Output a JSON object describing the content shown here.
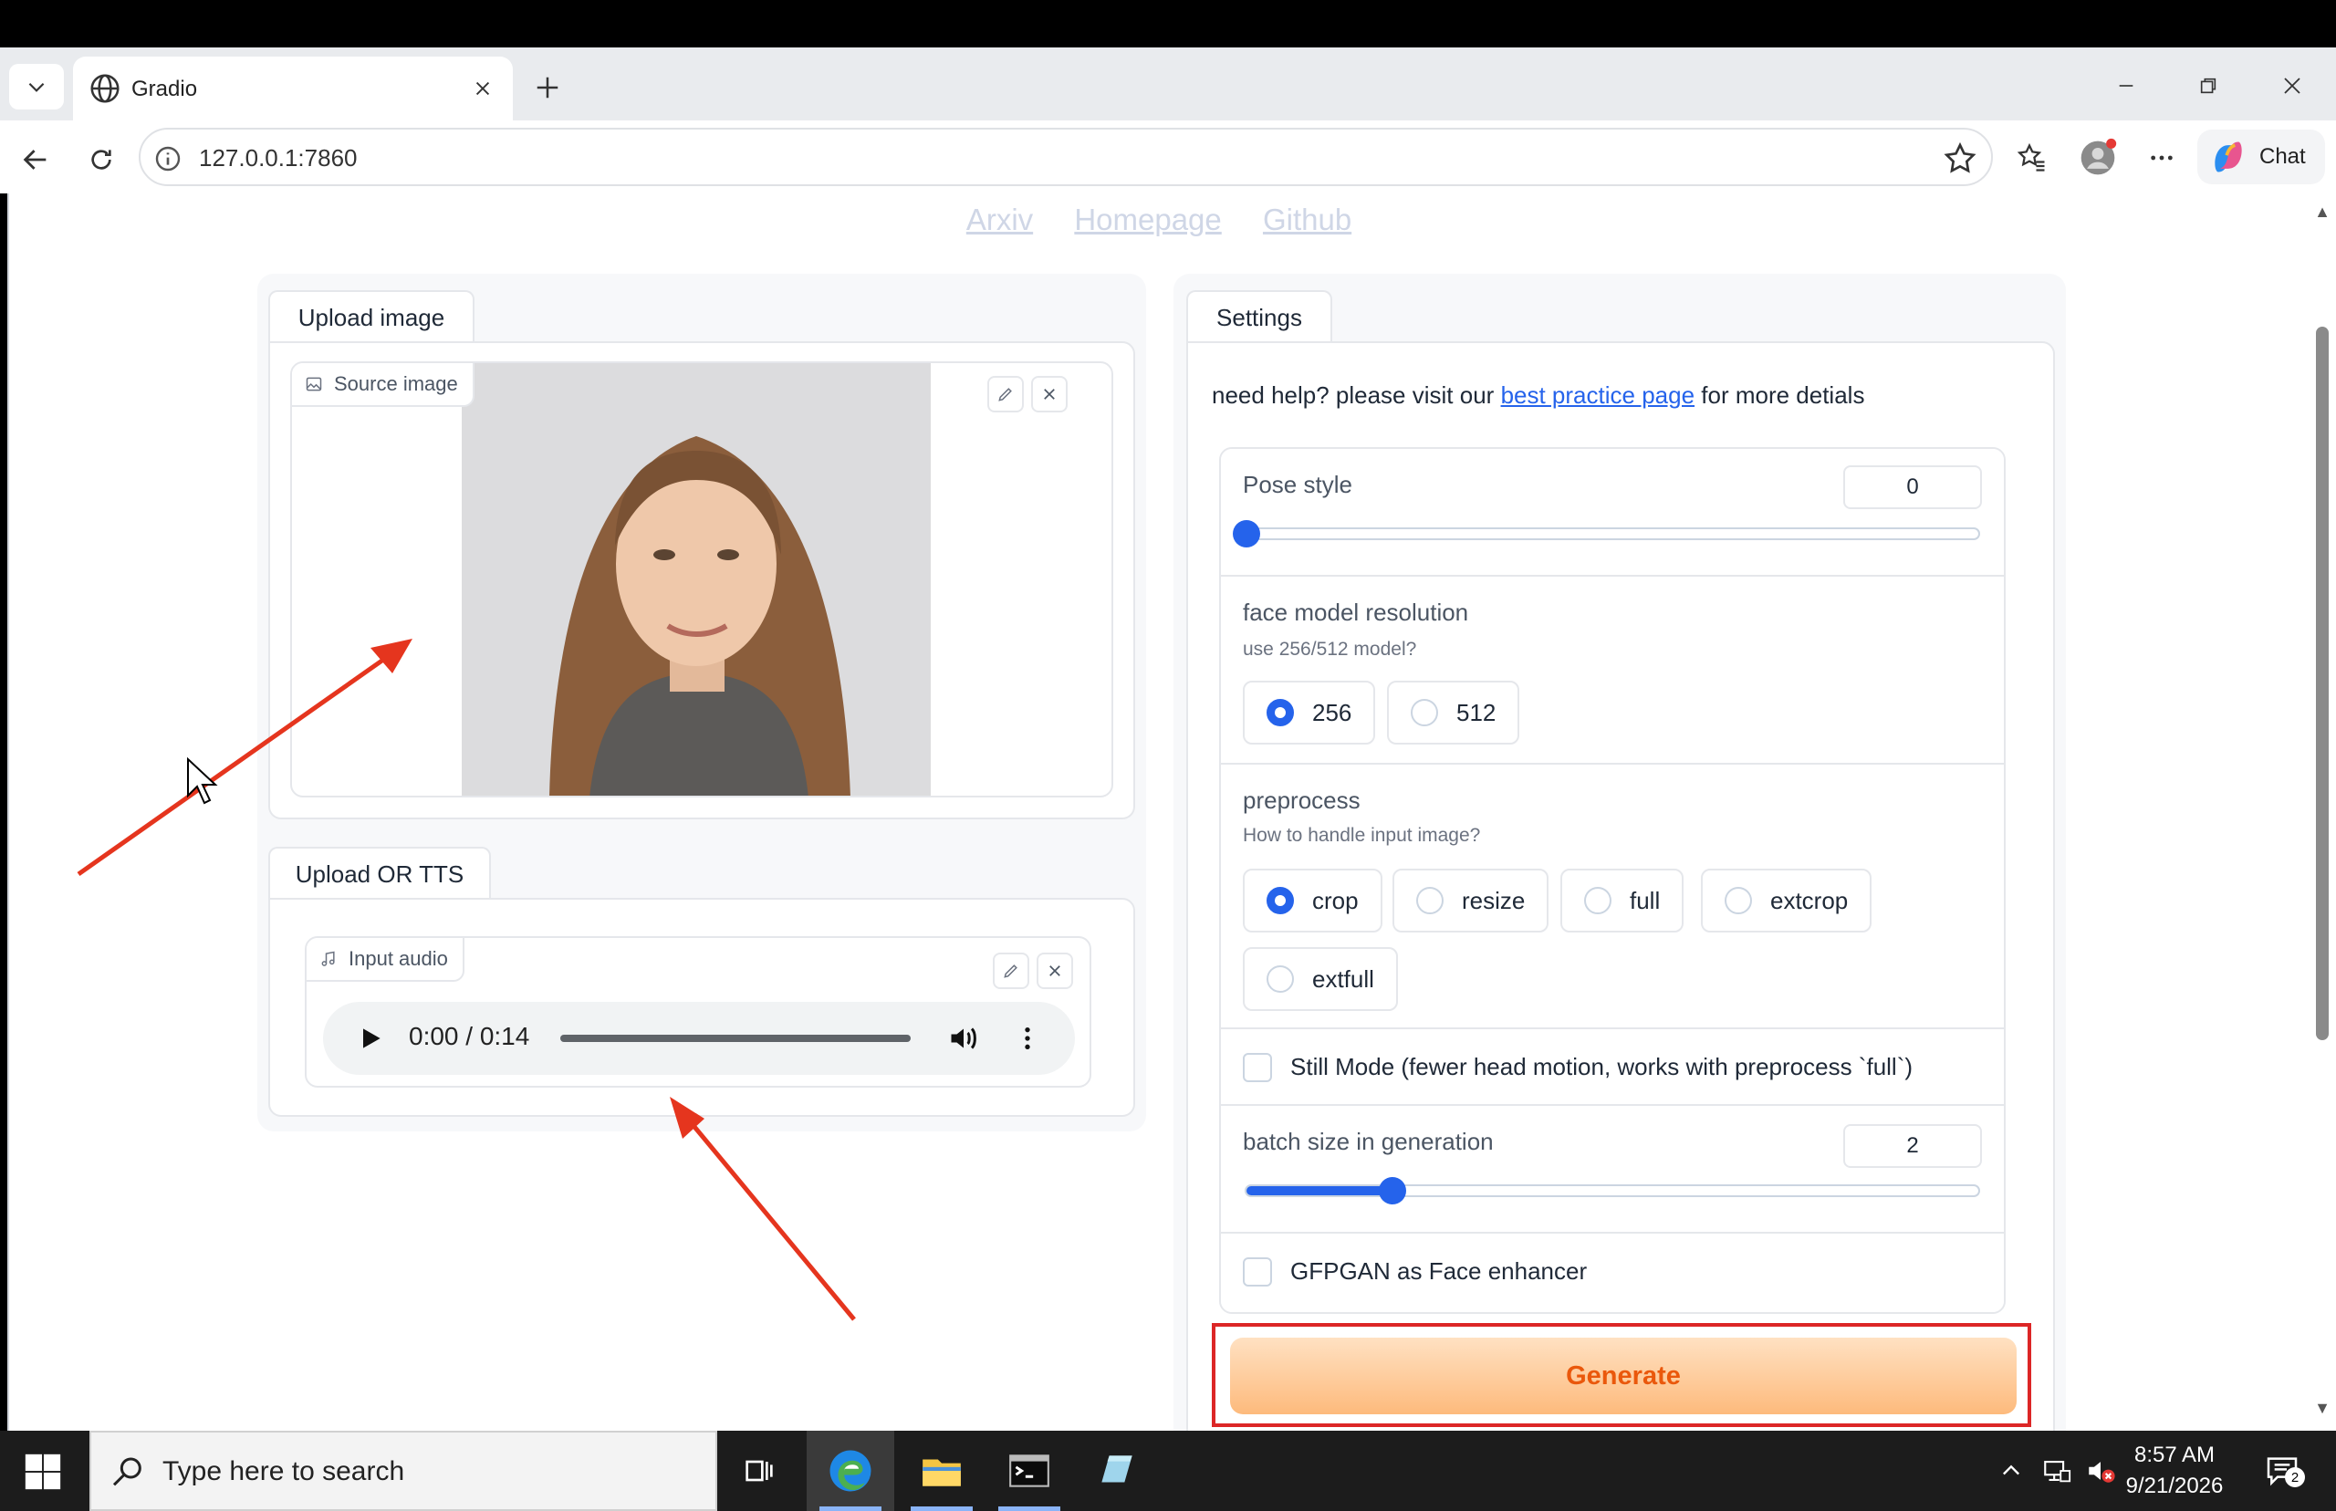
{
  "browser": {
    "tab_title": "Gradio",
    "url": "127.0.0.1:7860",
    "chat_label": "Chat"
  },
  "page": {
    "links": [
      "Arxiv",
      "Homepage",
      "Github"
    ],
    "upload_image_tab": "Upload image",
    "source_image_label": "Source image",
    "upload_tts_tab": "Upload OR TTS",
    "input_audio_label": "Input audio",
    "audio_time": "0:00 / 0:14",
    "settings_tab": "Settings",
    "help_prefix": "need help? please visit our",
    "help_link": "best practice page",
    "help_suffix": "for more detials"
  },
  "settings": {
    "pose_style": {
      "label": "Pose style",
      "value": "0",
      "fraction": 0.0
    },
    "face_model": {
      "label": "face model resolution",
      "info": "use 256/512 model?",
      "options": [
        "256",
        "512"
      ],
      "selected": "256"
    },
    "preprocess": {
      "label": "preprocess",
      "info": "How to handle input image?",
      "options": [
        "crop",
        "resize",
        "full",
        "extcrop",
        "extfull"
      ],
      "selected": "crop"
    },
    "still_mode": {
      "label": "Still Mode (fewer head motion, works with preprocess `full`)",
      "checked": false
    },
    "batch_size": {
      "label": "batch size in generation",
      "value": "2",
      "fraction": 0.2
    },
    "gfpgan": {
      "label": "GFPGAN as Face enhancer",
      "checked": false
    },
    "generate_label": "Generate"
  },
  "taskbar": {
    "search_placeholder": "Type here to search",
    "time": "8:57 AM",
    "date": "9/21/2026",
    "notification_count": "2"
  },
  "colors": {
    "accent_blue": "#2563eb",
    "generate_orange": "#ea580c",
    "annotation_red": "#dc2626"
  }
}
